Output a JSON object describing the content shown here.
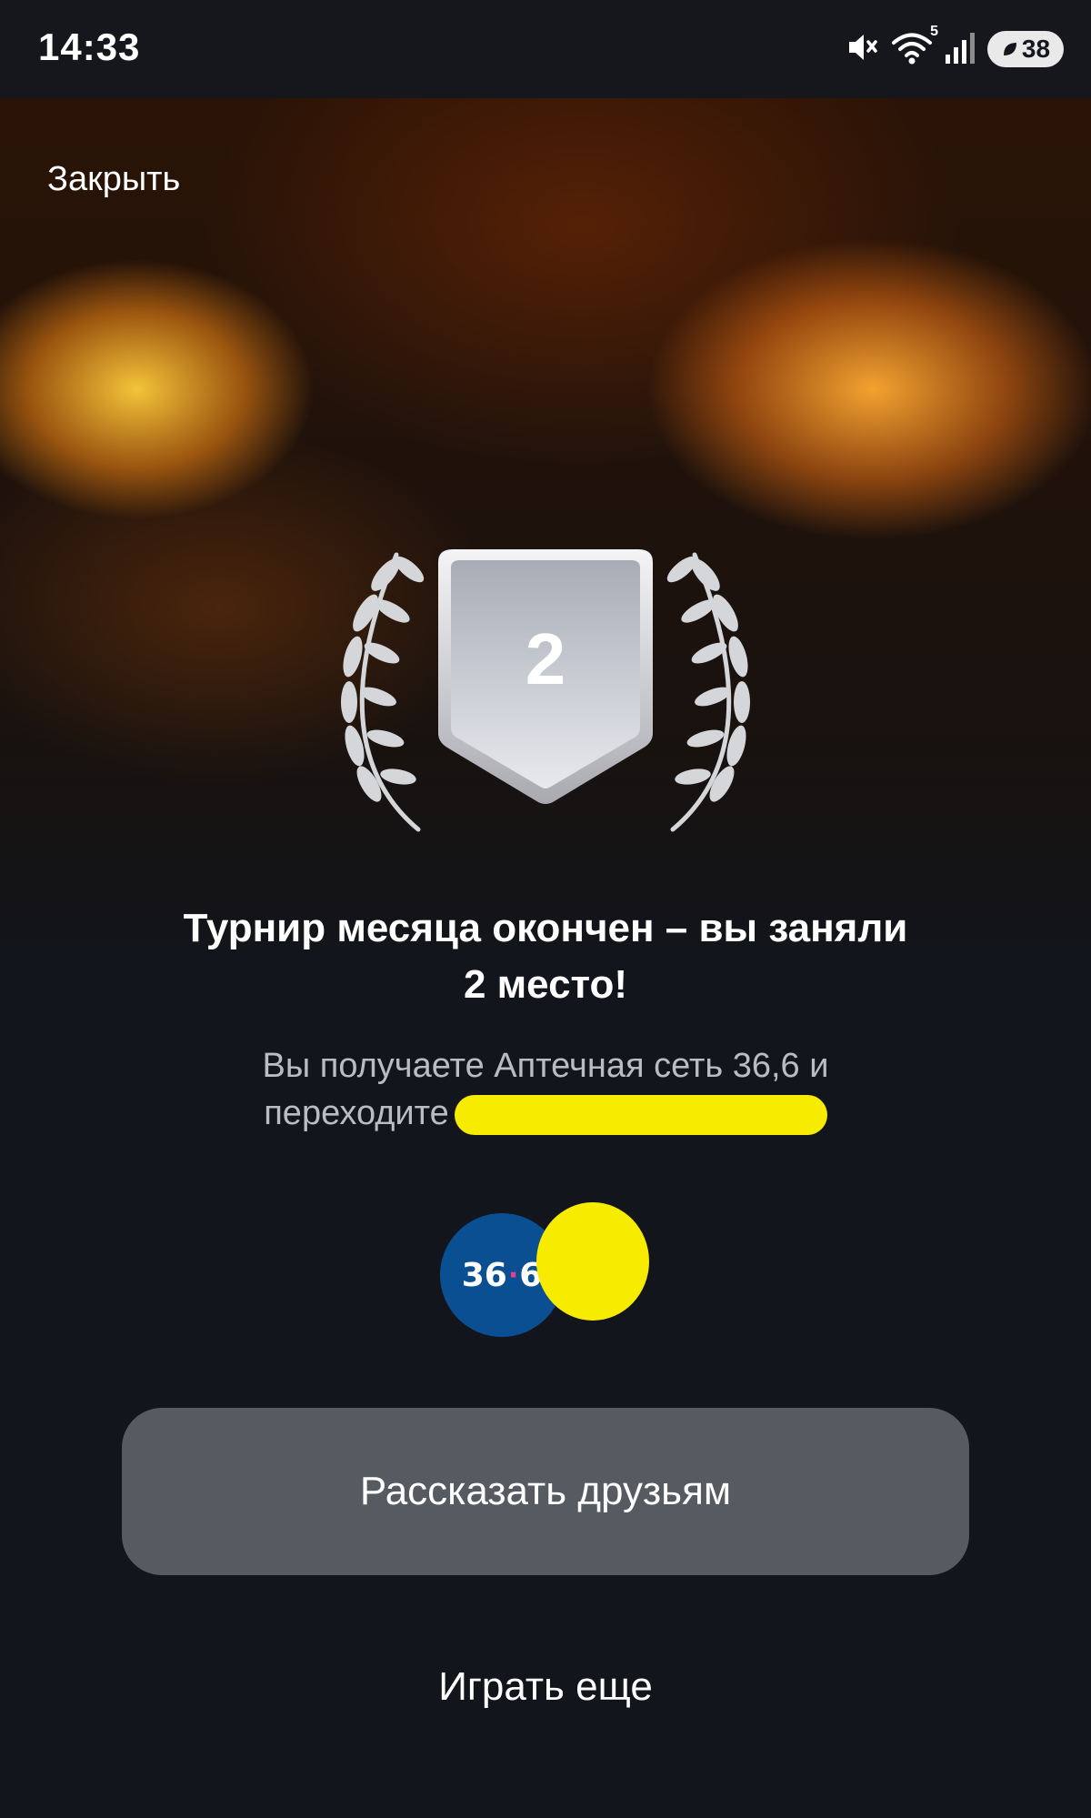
{
  "status_bar": {
    "time": "14:33",
    "battery": "38",
    "icons": [
      "mute-icon",
      "wifi-icon",
      "signal-icon",
      "battery-icon"
    ],
    "wifi_badge": "5"
  },
  "header": {
    "close_label": "Закрыть"
  },
  "badge": {
    "place": "2",
    "icons": [
      "laurel-left-icon",
      "shield-badge-icon",
      "laurel-right-icon"
    ]
  },
  "result": {
    "title_line1": "Турнир месяца окончен – вы заняли",
    "title_line2": "2 место!",
    "subtitle_line1": "Вы получаете Аптечная сеть 36,6 и",
    "subtitle_line2": "переходите"
  },
  "logo": {
    "text_left": "36",
    "text_dot": "·",
    "text_right": "6",
    "color": "#0b4f93",
    "dot_color": "#e8408f"
  },
  "actions": {
    "share_label": "Рассказать друзьям",
    "play_again_label": "Играть еще"
  },
  "colors": {
    "background": "#12151b",
    "button": "#565a61",
    "redaction": "#f7ec00",
    "subtitle_text": "#b9bcc3"
  }
}
